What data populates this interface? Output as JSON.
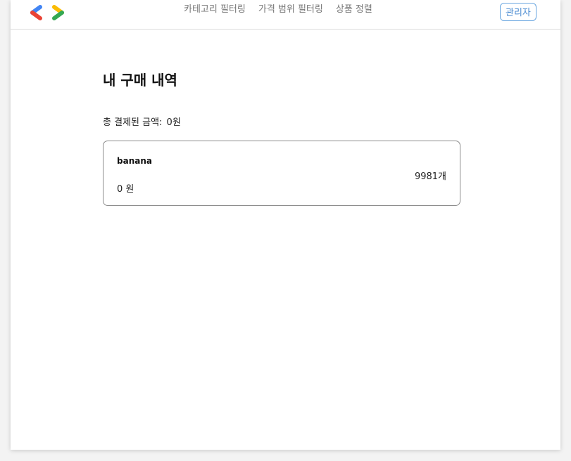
{
  "header": {
    "nav_items": [
      "카테고리 필터링",
      "가격 범위 필터링",
      "상품 정렬"
    ],
    "admin_label": "관리자",
    "logo_icon": "chevron-logo-icon",
    "logo_colors": {
      "blue": "#4285f4",
      "red": "#ea4335",
      "yellow": "#fbbc04",
      "green": "#34a853"
    }
  },
  "main": {
    "title": "내 구매 내역",
    "total_label": "총 결제된 금액:",
    "total_value": "0원",
    "orders": [
      {
        "name": "banana",
        "price": "0 원",
        "quantity": "9981개"
      }
    ]
  },
  "colors": {
    "accent": "#4a8bd1",
    "border": "#8c8c8c"
  }
}
